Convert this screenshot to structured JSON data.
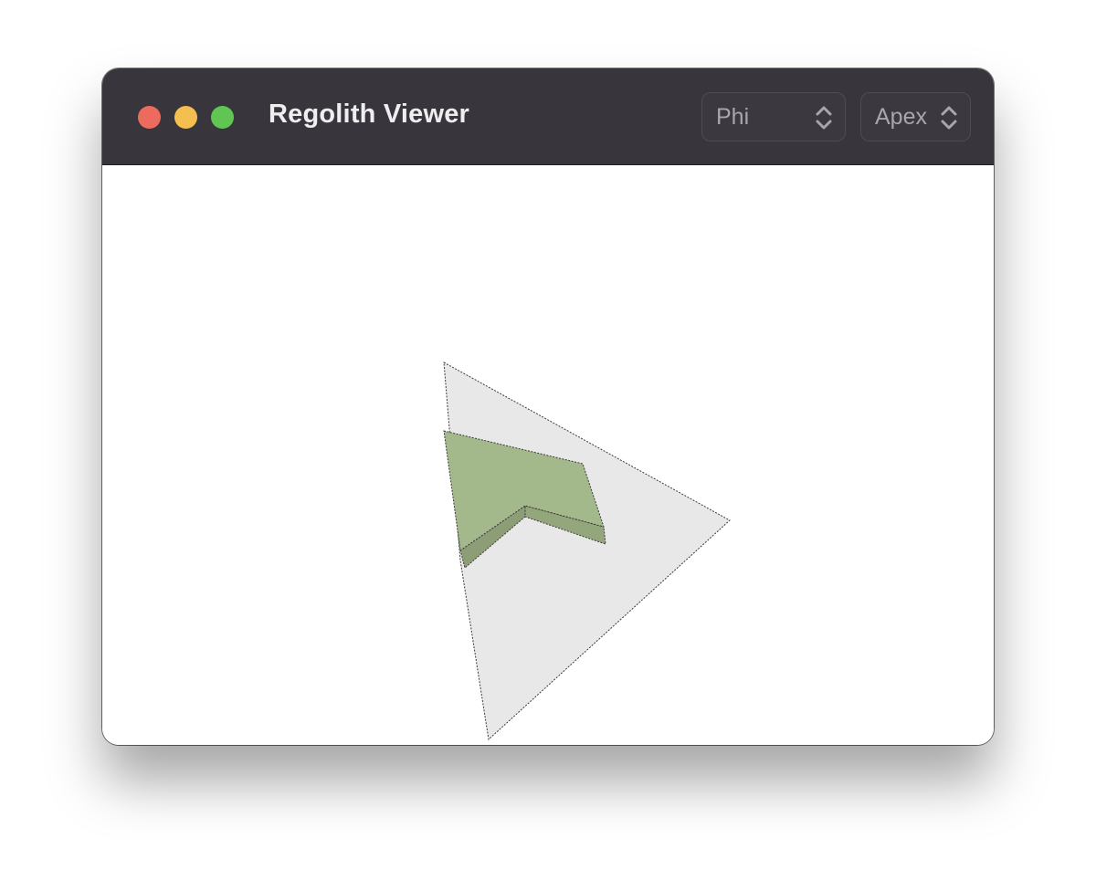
{
  "window": {
    "title": "Regolith Viewer"
  },
  "toolbar": {
    "mode_select": {
      "value": "Phi",
      "icon": "chevron-up-down-icon"
    },
    "view_select": {
      "value": "Apex",
      "icon": "chevron-up-down-icon"
    }
  },
  "colors": {
    "titlebar": "#38363c",
    "close": "#ed6a5e",
    "minimize": "#f5bf4f",
    "maximize": "#61c554",
    "plane": "#e8e8e8",
    "block_top": "#a3b98c",
    "block_side": "#8d9e76"
  }
}
